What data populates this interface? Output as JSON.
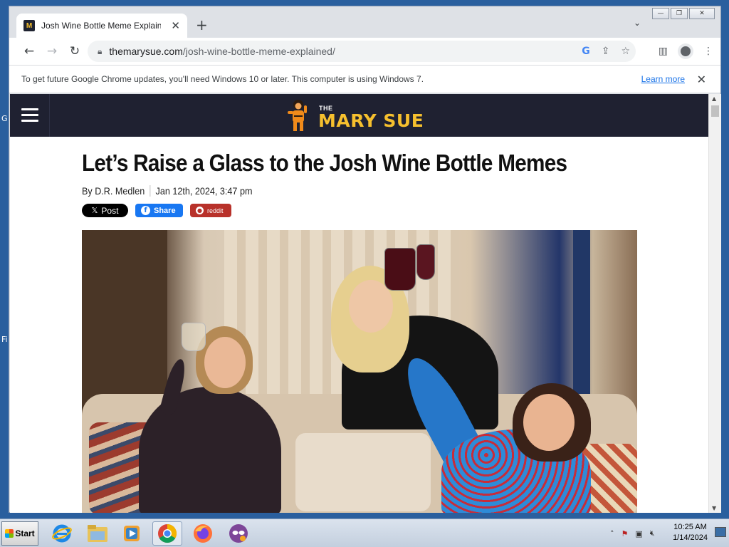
{
  "desktop": {
    "letters": [
      "G",
      "Fi"
    ]
  },
  "browser": {
    "tab": {
      "favicon": "M",
      "title": "Josh Wine Bottle Meme Explained |",
      "close": "✕"
    },
    "new_tab": "+",
    "tab_dropdown": "⌄",
    "window_controls": {
      "minimize": "—",
      "restore": "❐",
      "close": "✕"
    },
    "url": {
      "domain": "themarysue.com",
      "path": "/josh-wine-bottle-meme-explained/"
    },
    "infobar": {
      "text": "To get future Google Chrome updates, you'll need Windows 10 or later. This computer is using Windows 7.",
      "learn_more": "Learn more"
    }
  },
  "site": {
    "logo_the": "THE",
    "logo_name": "MARY SUE"
  },
  "article": {
    "headline": "Let’s Raise a Glass to the Josh Wine Bottle Memes",
    "author": "By D.R. Medlen",
    "date": "Jan 12th, 2024, 3:47 pm",
    "share_x": "Post",
    "share_fb": "Share",
    "share_reddit": "reddit"
  },
  "taskbar": {
    "start": "Start",
    "time": "10:25 AM",
    "date": "1/14/2024",
    "apps": [
      "internet-explorer",
      "file-explorer",
      "media-player",
      "chrome",
      "firefox",
      "tor-browser"
    ]
  },
  "colors": {
    "site_header": "#1f2131",
    "logo_yellow": "#f6c02e",
    "fb_blue": "#1877f2",
    "reddit_red": "#b8312a"
  }
}
